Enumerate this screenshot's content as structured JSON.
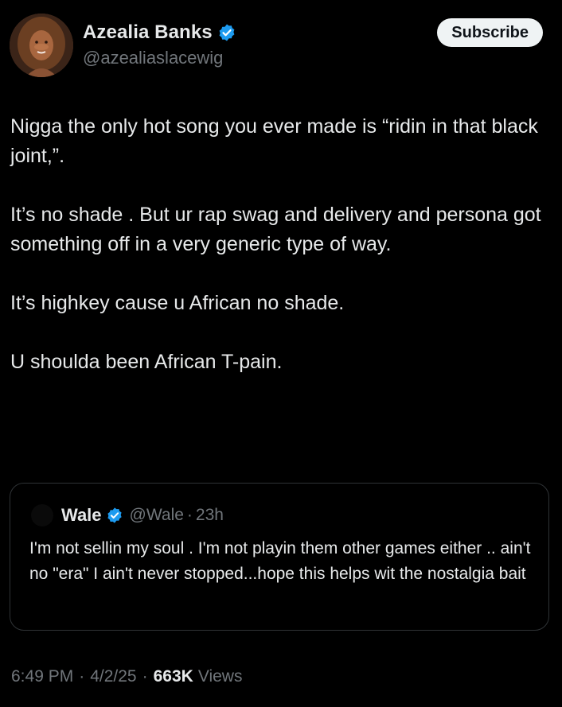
{
  "tweet": {
    "author": {
      "display_name": "Azealia Banks",
      "handle": "@azealiaslacewig",
      "verified_icon": "verified-badge-icon",
      "verified_color": "#1d9bf0"
    },
    "subscribe_label": "Subscribe",
    "body": [
      "Nigga the only hot song you ever made is “ridin in that black joint,”.",
      "It’s no shade . But ur rap swag and delivery and persona got something off in a very generic type of way.",
      "It’s highkey cause u African no shade.",
      "U shoulda been African T-pain."
    ],
    "quoted": {
      "display_name": "Wale",
      "handle": "@Wale",
      "time": "23h",
      "text": "I'm not sellin my soul . I'm not playin them other games either .. ain't no \"era\" I ain't never stopped...hope this helps wit the nostalgia bait"
    },
    "meta": {
      "time": "6:49 PM",
      "date": "4/2/25",
      "views_count": "663K",
      "views_label": "Views"
    }
  },
  "colors": {
    "background": "#000000",
    "text": "#e7e9ea",
    "muted": "#71767b",
    "border": "#2f3336",
    "accent": "#1d9bf0"
  }
}
